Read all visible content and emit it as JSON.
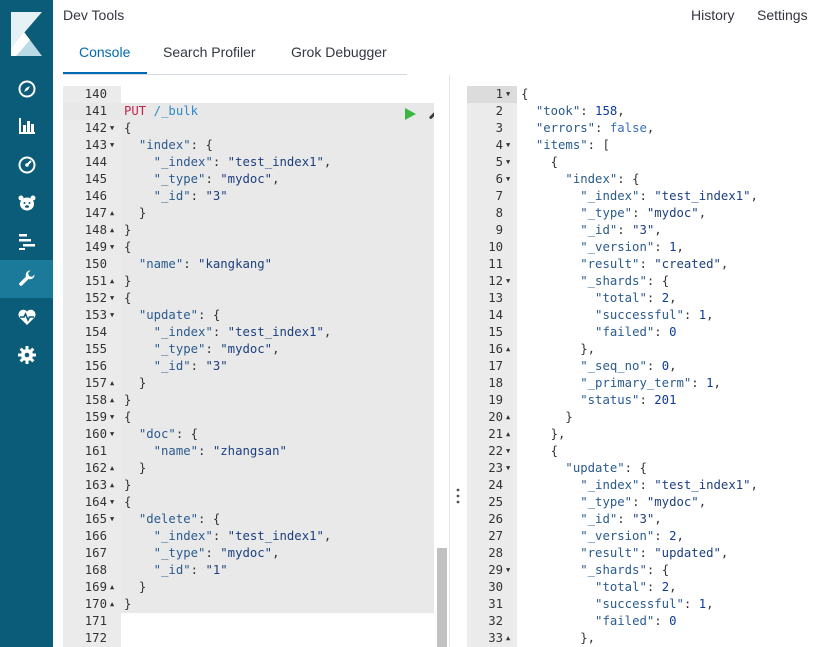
{
  "app": {
    "title": "Dev Tools",
    "history_label": "History",
    "settings_label": "Settings"
  },
  "tabs": [
    {
      "label": "Console",
      "active": true
    },
    {
      "label": "Search Profiler",
      "active": false
    },
    {
      "label": "Grok Debugger",
      "active": false
    }
  ],
  "sidebar": {
    "items": [
      {
        "icon": "compass-icon",
        "label": "Discover"
      },
      {
        "icon": "bar-chart-icon",
        "label": "Visualize"
      },
      {
        "icon": "dashboard-icon",
        "label": "Dashboard"
      },
      {
        "icon": "bear-icon",
        "label": "Timelion"
      },
      {
        "icon": "apm-icon",
        "label": "APM"
      },
      {
        "icon": "wrench-icon",
        "label": "Dev Tools",
        "active": true
      },
      {
        "icon": "heartbeat-icon",
        "label": "Monitoring"
      },
      {
        "icon": "gear-icon",
        "label": "Management"
      }
    ]
  },
  "colors": {
    "sidebar": "#0a5c78",
    "accent": "#006bb4",
    "run": "#3cb643"
  },
  "request": {
    "lines": [
      {
        "n": "140",
        "t": ""
      },
      {
        "n": "141",
        "t": "PUT /_bulk",
        "method": "PUT",
        "url": "/_bulk"
      },
      {
        "n": "142",
        "f": "v",
        "t": "{"
      },
      {
        "n": "143",
        "f": "v",
        "t": "  \"index\": {"
      },
      {
        "n": "144",
        "t": "    \"_index\": \"test_index1\","
      },
      {
        "n": "145",
        "t": "    \"_type\": \"mydoc\","
      },
      {
        "n": "146",
        "t": "    \"_id\": \"3\""
      },
      {
        "n": "147",
        "f": "^",
        "t": "  }"
      },
      {
        "n": "148",
        "f": "^",
        "t": "}"
      },
      {
        "n": "149",
        "f": "v",
        "t": "{"
      },
      {
        "n": "150",
        "t": "  \"name\": \"kangkang\""
      },
      {
        "n": "151",
        "f": "^",
        "t": "}"
      },
      {
        "n": "152",
        "f": "v",
        "t": "{"
      },
      {
        "n": "153",
        "f": "v",
        "t": "  \"update\": {"
      },
      {
        "n": "154",
        "t": "    \"_index\": \"test_index1\","
      },
      {
        "n": "155",
        "t": "    \"_type\": \"mydoc\","
      },
      {
        "n": "156",
        "t": "    \"_id\": \"3\""
      },
      {
        "n": "157",
        "f": "^",
        "t": "  }"
      },
      {
        "n": "158",
        "f": "^",
        "t": "}"
      },
      {
        "n": "159",
        "f": "v",
        "t": "{"
      },
      {
        "n": "160",
        "f": "v",
        "t": "  \"doc\": {"
      },
      {
        "n": "161",
        "t": "    \"name\": \"zhangsan\""
      },
      {
        "n": "162",
        "f": "^",
        "t": "  }"
      },
      {
        "n": "163",
        "f": "^",
        "t": "}"
      },
      {
        "n": "164",
        "f": "v",
        "t": "{"
      },
      {
        "n": "165",
        "f": "v",
        "t": "  \"delete\": {"
      },
      {
        "n": "166",
        "t": "    \"_index\": \"test_index1\","
      },
      {
        "n": "167",
        "t": "    \"_type\": \"mydoc\","
      },
      {
        "n": "168",
        "t": "    \"_id\": \"1\""
      },
      {
        "n": "169",
        "f": "^",
        "t": "  }"
      },
      {
        "n": "170",
        "f": "^",
        "t": "}"
      },
      {
        "n": "171",
        "t": ""
      },
      {
        "n": "172",
        "t": ""
      }
    ]
  },
  "response": {
    "lines": [
      {
        "n": "1",
        "f": "v",
        "t": "{"
      },
      {
        "n": "2",
        "t": "  \"took\": 158,"
      },
      {
        "n": "3",
        "t": "  \"errors\": false,"
      },
      {
        "n": "4",
        "f": "v",
        "t": "  \"items\": ["
      },
      {
        "n": "5",
        "f": "v",
        "t": "    {"
      },
      {
        "n": "6",
        "f": "v",
        "t": "      \"index\": {"
      },
      {
        "n": "7",
        "t": "        \"_index\": \"test_index1\","
      },
      {
        "n": "8",
        "t": "        \"_type\": \"mydoc\","
      },
      {
        "n": "9",
        "t": "        \"_id\": \"3\","
      },
      {
        "n": "10",
        "t": "        \"_version\": 1,"
      },
      {
        "n": "11",
        "t": "        \"result\": \"created\","
      },
      {
        "n": "12",
        "f": "v",
        "t": "        \"_shards\": {"
      },
      {
        "n": "13",
        "t": "          \"total\": 2,"
      },
      {
        "n": "14",
        "t": "          \"successful\": 1,"
      },
      {
        "n": "15",
        "t": "          \"failed\": 0"
      },
      {
        "n": "16",
        "f": "^",
        "t": "        },"
      },
      {
        "n": "17",
        "t": "        \"_seq_no\": 0,"
      },
      {
        "n": "18",
        "t": "        \"_primary_term\": 1,"
      },
      {
        "n": "19",
        "t": "        \"status\": 201"
      },
      {
        "n": "20",
        "f": "^",
        "t": "      }"
      },
      {
        "n": "21",
        "f": "^",
        "t": "    },"
      },
      {
        "n": "22",
        "f": "v",
        "t": "    {"
      },
      {
        "n": "23",
        "f": "v",
        "t": "      \"update\": {"
      },
      {
        "n": "24",
        "t": "        \"_index\": \"test_index1\","
      },
      {
        "n": "25",
        "t": "        \"_type\": \"mydoc\","
      },
      {
        "n": "26",
        "t": "        \"_id\": \"3\","
      },
      {
        "n": "27",
        "t": "        \"_version\": 2,"
      },
      {
        "n": "28",
        "t": "        \"result\": \"updated\","
      },
      {
        "n": "29",
        "f": "v",
        "t": "        \"_shards\": {"
      },
      {
        "n": "30",
        "t": "          \"total\": 2,"
      },
      {
        "n": "31",
        "t": "          \"successful\": 1,"
      },
      {
        "n": "32",
        "t": "          \"failed\": 0"
      },
      {
        "n": "33",
        "f": "^",
        "t": "        },"
      }
    ]
  }
}
